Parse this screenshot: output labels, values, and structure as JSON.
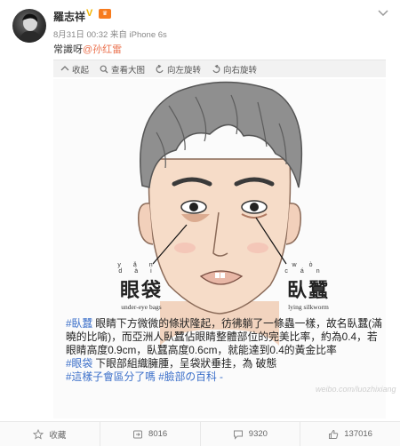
{
  "user": {
    "name": "羅志祥",
    "verified_icon": "verified-v-icon",
    "badge_icon": "crown-icon"
  },
  "post": {
    "meta": "8月31日 00:32 来自 iPhone 6s",
    "text_prefix": "常識呀",
    "mention": "@孙红雷"
  },
  "toolbar": {
    "collect": "收起",
    "view_large": "查看大图",
    "rotate_left": "向左旋转",
    "rotate_right": "向右旋转"
  },
  "image": {
    "left_pinyin": "yǎn dài",
    "left_label": "眼袋",
    "left_sub": "under-eye bags",
    "right_pinyin": "wò cán",
    "right_label": "臥蠶",
    "right_sub": "lying silkworm",
    "caption_1_tag": "#臥蠶",
    "caption_1_text": " 眼睛下方微微的條狀隆起，彷彿躺了一條蟲一樣，故名臥蠶(滿曉的比喻)，而亞洲人臥蠶佔眼睛整體部位的完美比率，約為0.4，若眼睛高度0.9cm，臥蠶高度0.6cm，就能達到0.4的黃金比率",
    "caption_2_tag": "#眼袋",
    "caption_2_text": " 下眼部組織臃腫，呈袋狀垂挂，為 破態 ",
    "caption_3_tag1": "#這樣子會區分了嗎",
    "caption_3_tag2": " #臉部の百科 -",
    "watermark": "weibo.com/luozhixiang"
  },
  "footer": {
    "collect": "收藏",
    "repost_count": "8016",
    "comment_count": "9320",
    "like_count": "137016"
  },
  "colors": {
    "mention": "#eb7350",
    "tag": "#3b6fc9",
    "toolbar_bg": "#f2f2f2"
  }
}
